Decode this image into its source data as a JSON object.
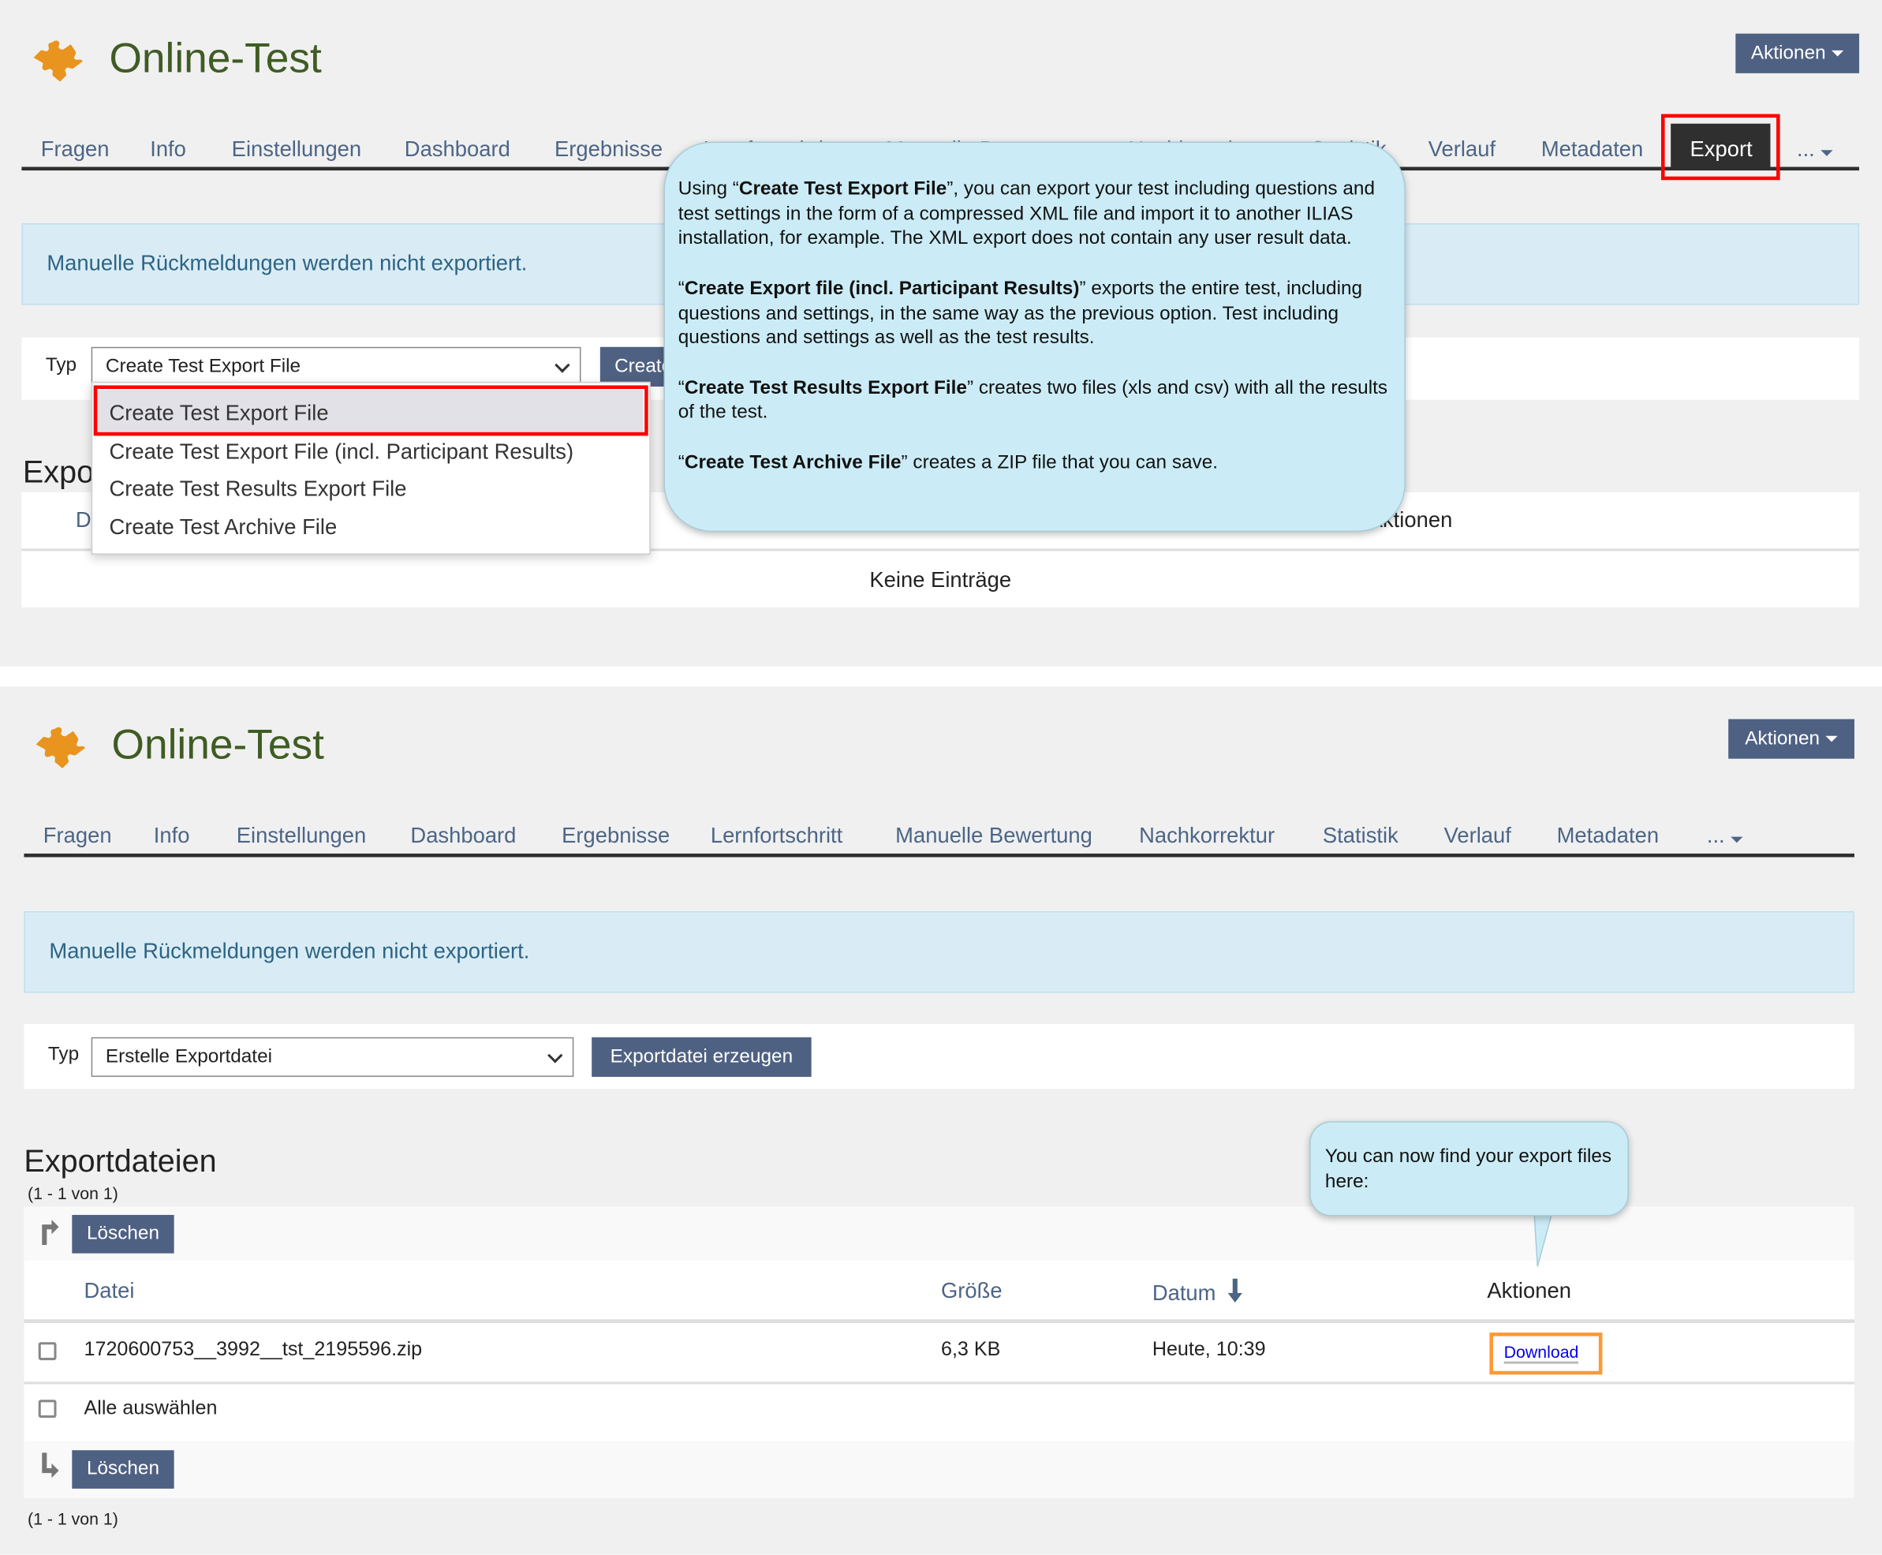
{
  "colors": {
    "brand_title": "#3f5c23",
    "puzzle_icon": "#e8941e",
    "button": "#4f6182",
    "info_text": "#2d6384",
    "highlight_red": "#ff0000",
    "highlight_orange": "#ff9933",
    "bubble": "#cbecf6"
  },
  "top": {
    "title": "Online-Test",
    "aktionen": "Aktionen",
    "tabs": [
      "Fragen",
      "Info",
      "Einstellungen",
      "Dashboard",
      "Ergebnisse",
      "Lernfortschritt",
      "Manuelle Bewertung",
      "Nachkorrektur",
      "Statistik",
      "Verlauf",
      "Metadaten",
      "Export",
      "..."
    ],
    "active_tab": "Export",
    "info": "Manuelle Rückmeldungen werden nicht exportiert.",
    "typ_label": "Typ",
    "select_value": "Create Test Export File",
    "create_button": "Create",
    "dropdown_options": [
      "Create Test Export File",
      "Create Test Export File (incl. Participant Results)",
      "Create Test Results Export File",
      "Create Test Archive File"
    ],
    "section_heading": "Exportdateien",
    "col_datei": "Datei",
    "col_aktionen": "Aktionen",
    "empty": "Keine Einträge",
    "callout": [
      {
        "pre": "Using “",
        "bold": "Create Test Export File",
        "post": "”, you can export your test including questions and test settings in the form of a compressed XML file and import it to another ILIAS installation, for example. The XML export does not contain any user result data."
      },
      {
        "pre": "“",
        "bold": "Create Export file (incl. Participant Results)",
        "post": "” exports the entire test, including questions and settings, in the same way as the previous option. Test including questions and settings as well as the test results."
      },
      {
        "pre": "“",
        "bold": "Create Test Results Export File",
        "post": "” creates two files (xls and csv) with all the results of the test."
      },
      {
        "pre": "“",
        "bold": "Create Test Archive File",
        "post": "” creates a ZIP file that you can save."
      }
    ]
  },
  "bottom": {
    "title": "Online-Test",
    "aktionen": "Aktionen",
    "tabs": [
      "Fragen",
      "Info",
      "Einstellungen",
      "Dashboard",
      "Ergebnisse",
      "Lernfortschritt",
      "Manuelle Bewertung",
      "Nachkorrektur",
      "Statistik",
      "Verlauf",
      "Metadaten",
      "..."
    ],
    "info": "Manuelle Rückmeldungen werden nicht exportiert.",
    "typ_label": "Typ",
    "select_value": "Erstelle Exportdatei",
    "create_button": "Exportdatei erzeugen",
    "section_heading": "Exportdateien",
    "pagination": "(1 - 1 von 1)",
    "delete_button": "Löschen",
    "columns": [
      "Datei",
      "Größe",
      "Datum",
      "Aktionen"
    ],
    "rows": [
      {
        "file": "1720600753__3992__tst_2195596.zip",
        "size": "6,3 KB",
        "date": "Heute, 10:39",
        "action": "Download"
      }
    ],
    "select_all": "Alle auswählen",
    "callout": "You can now find your export files here:"
  }
}
